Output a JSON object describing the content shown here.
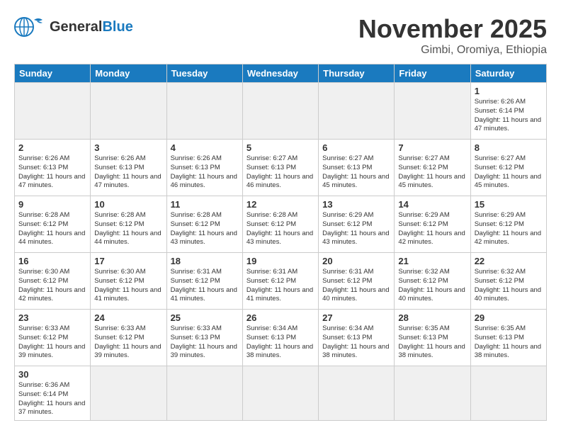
{
  "header": {
    "logo_general": "General",
    "logo_blue": "Blue",
    "month_title": "November 2025",
    "location": "Gimbi, Oromiya, Ethiopia"
  },
  "weekdays": [
    "Sunday",
    "Monday",
    "Tuesday",
    "Wednesday",
    "Thursday",
    "Friday",
    "Saturday"
  ],
  "weeks": [
    [
      {
        "day": "",
        "empty": true
      },
      {
        "day": "",
        "empty": true
      },
      {
        "day": "",
        "empty": true
      },
      {
        "day": "",
        "empty": true
      },
      {
        "day": "",
        "empty": true
      },
      {
        "day": "",
        "empty": true
      },
      {
        "day": "1",
        "sunrise": "6:26 AM",
        "sunset": "6:14 PM",
        "daylight": "11 hours and 47 minutes."
      }
    ],
    [
      {
        "day": "2",
        "sunrise": "6:26 AM",
        "sunset": "6:13 PM",
        "daylight": "11 hours and 47 minutes."
      },
      {
        "day": "3",
        "sunrise": "6:26 AM",
        "sunset": "6:13 PM",
        "daylight": "11 hours and 47 minutes."
      },
      {
        "day": "4",
        "sunrise": "6:26 AM",
        "sunset": "6:13 PM",
        "daylight": "11 hours and 46 minutes."
      },
      {
        "day": "5",
        "sunrise": "6:27 AM",
        "sunset": "6:13 PM",
        "daylight": "11 hours and 46 minutes."
      },
      {
        "day": "6",
        "sunrise": "6:27 AM",
        "sunset": "6:13 PM",
        "daylight": "11 hours and 45 minutes."
      },
      {
        "day": "7",
        "sunrise": "6:27 AM",
        "sunset": "6:12 PM",
        "daylight": "11 hours and 45 minutes."
      },
      {
        "day": "8",
        "sunrise": "6:27 AM",
        "sunset": "6:12 PM",
        "daylight": "11 hours and 45 minutes."
      }
    ],
    [
      {
        "day": "9",
        "sunrise": "6:28 AM",
        "sunset": "6:12 PM",
        "daylight": "11 hours and 44 minutes."
      },
      {
        "day": "10",
        "sunrise": "6:28 AM",
        "sunset": "6:12 PM",
        "daylight": "11 hours and 44 minutes."
      },
      {
        "day": "11",
        "sunrise": "6:28 AM",
        "sunset": "6:12 PM",
        "daylight": "11 hours and 43 minutes."
      },
      {
        "day": "12",
        "sunrise": "6:28 AM",
        "sunset": "6:12 PM",
        "daylight": "11 hours and 43 minutes."
      },
      {
        "day": "13",
        "sunrise": "6:29 AM",
        "sunset": "6:12 PM",
        "daylight": "11 hours and 43 minutes."
      },
      {
        "day": "14",
        "sunrise": "6:29 AM",
        "sunset": "6:12 PM",
        "daylight": "11 hours and 42 minutes."
      },
      {
        "day": "15",
        "sunrise": "6:29 AM",
        "sunset": "6:12 PM",
        "daylight": "11 hours and 42 minutes."
      }
    ],
    [
      {
        "day": "16",
        "sunrise": "6:30 AM",
        "sunset": "6:12 PM",
        "daylight": "11 hours and 42 minutes."
      },
      {
        "day": "17",
        "sunrise": "6:30 AM",
        "sunset": "6:12 PM",
        "daylight": "11 hours and 41 minutes."
      },
      {
        "day": "18",
        "sunrise": "6:31 AM",
        "sunset": "6:12 PM",
        "daylight": "11 hours and 41 minutes."
      },
      {
        "day": "19",
        "sunrise": "6:31 AM",
        "sunset": "6:12 PM",
        "daylight": "11 hours and 41 minutes."
      },
      {
        "day": "20",
        "sunrise": "6:31 AM",
        "sunset": "6:12 PM",
        "daylight": "11 hours and 40 minutes."
      },
      {
        "day": "21",
        "sunrise": "6:32 AM",
        "sunset": "6:12 PM",
        "daylight": "11 hours and 40 minutes."
      },
      {
        "day": "22",
        "sunrise": "6:32 AM",
        "sunset": "6:12 PM",
        "daylight": "11 hours and 40 minutes."
      }
    ],
    [
      {
        "day": "23",
        "sunrise": "6:33 AM",
        "sunset": "6:12 PM",
        "daylight": "11 hours and 39 minutes."
      },
      {
        "day": "24",
        "sunrise": "6:33 AM",
        "sunset": "6:12 PM",
        "daylight": "11 hours and 39 minutes."
      },
      {
        "day": "25",
        "sunrise": "6:33 AM",
        "sunset": "6:13 PM",
        "daylight": "11 hours and 39 minutes."
      },
      {
        "day": "26",
        "sunrise": "6:34 AM",
        "sunset": "6:13 PM",
        "daylight": "11 hours and 38 minutes."
      },
      {
        "day": "27",
        "sunrise": "6:34 AM",
        "sunset": "6:13 PM",
        "daylight": "11 hours and 38 minutes."
      },
      {
        "day": "28",
        "sunrise": "6:35 AM",
        "sunset": "6:13 PM",
        "daylight": "11 hours and 38 minutes."
      },
      {
        "day": "29",
        "sunrise": "6:35 AM",
        "sunset": "6:13 PM",
        "daylight": "11 hours and 38 minutes."
      }
    ],
    [
      {
        "day": "30",
        "sunrise": "6:36 AM",
        "sunset": "6:14 PM",
        "daylight": "11 hours and 37 minutes."
      },
      {
        "day": "",
        "empty": true
      },
      {
        "day": "",
        "empty": true
      },
      {
        "day": "",
        "empty": true
      },
      {
        "day": "",
        "empty": true
      },
      {
        "day": "",
        "empty": true
      },
      {
        "day": "",
        "empty": true
      }
    ]
  ]
}
